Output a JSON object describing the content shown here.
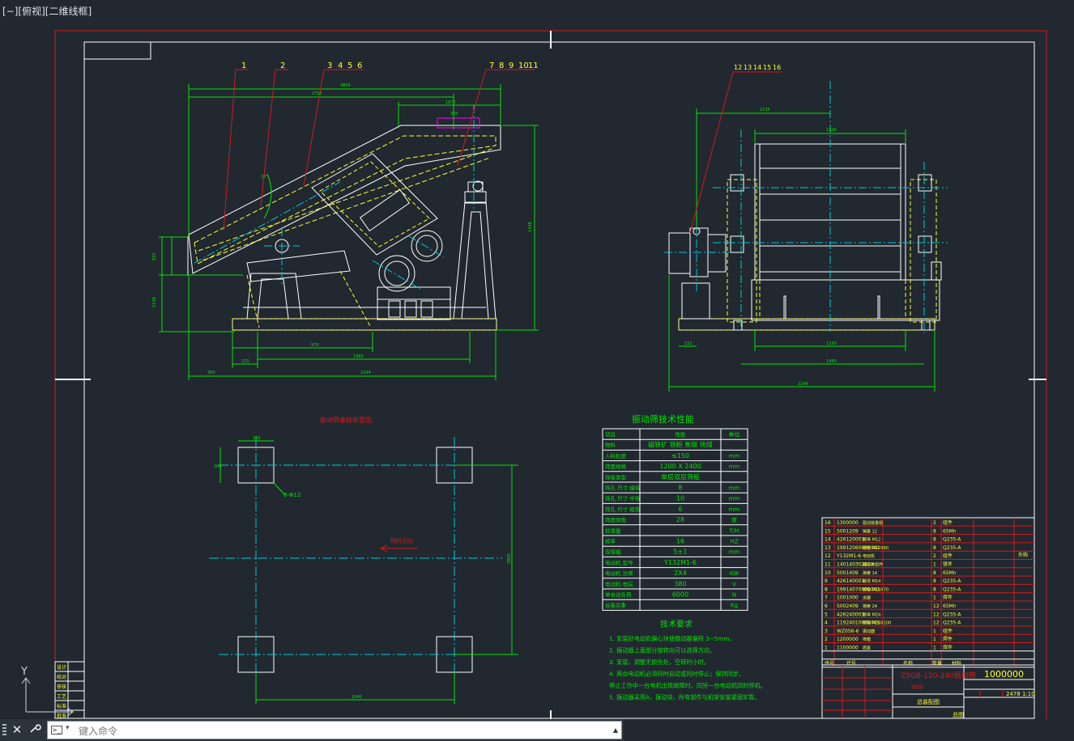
{
  "viewport": {
    "label": "[−][俯视][二维线框]"
  },
  "ucs": {
    "y_label": "Y"
  },
  "command_line": {
    "placeholder": "键入命令",
    "close_icon": "close-icon",
    "customize_icon": "wrench-icon",
    "prompt_icon": "command-prompt-icon"
  },
  "colors": {
    "background": "#212830",
    "frame": "#d51a1a",
    "geometry": "#ffffff",
    "dimension": "#00e600",
    "center_line": "#00c8d6",
    "hidden": "#ffff33",
    "magenta": "#ff00ff"
  },
  "drawing": {
    "callouts_left": [
      "1",
      "2",
      "3",
      "4",
      "5",
      "6",
      "7",
      "8",
      "9",
      "10",
      "11"
    ],
    "callouts_right": [
      "12",
      "13",
      "14",
      "15",
      "16"
    ],
    "side_view_dims": {
      "top_overall": "3869",
      "top_inner": "2752",
      "top_right": "1870",
      "bottom_1": "970",
      "bottom_2": "1960",
      "bottom_left": "220",
      "bottom_total": "2244",
      "bottom_offset": "360",
      "height": "1438",
      "left_upper": "835",
      "left_lower": "1148",
      "angle": "20°"
    },
    "end_view_dims": {
      "top": "1326",
      "top_left": "1135",
      "bottom_inner": "1250",
      "bottom_mid": "1480",
      "bottom_total": "2244",
      "left_small": "152"
    },
    "foundation": {
      "title": "振动筛基础布置图",
      "dim_top": "300",
      "dim_left": "300",
      "bore_label": "8-Φ12",
      "direction_label": "物料方向",
      "dim_bottom": "1640",
      "dim_right": "2800"
    }
  },
  "spec_table": {
    "title": "振动筛技术性能",
    "header": [
      "项目",
      "性能",
      "单位"
    ],
    "rows": [
      [
        "物料",
        "磁铁矿 铁粉 焦碳 块煤",
        ""
      ],
      [
        "入料粒度",
        "≤150",
        "mm"
      ],
      [
        "筛面规格",
        "1200 X 2400",
        "mm"
      ],
      [
        "筛板类型",
        "单层双层筛板",
        ""
      ],
      [
        "筛孔 尺寸 细筛",
        "8",
        "mm"
      ],
      [
        "筛孔 尺寸 中筛",
        "10",
        "mm"
      ],
      [
        "筛孔 尺寸 粗筛",
        "6",
        "mm"
      ],
      [
        "筛面倾角",
        "28",
        "度"
      ],
      [
        "处理量",
        "",
        "T/H"
      ],
      [
        "频率",
        "16",
        "HZ"
      ],
      [
        "双振幅",
        "5±1",
        "mm"
      ],
      [
        "电动机 型号",
        "Y132M1-6",
        ""
      ],
      [
        "电动机 功率",
        "2X4",
        "KW"
      ],
      [
        "电动机 电压",
        "380",
        "V"
      ],
      [
        "单台动负荷",
        "6000",
        "N"
      ],
      [
        "设备总重",
        "",
        "Kg"
      ]
    ]
  },
  "tech_requirements": {
    "title": "技术要求",
    "items": [
      "1. 安装好电动机偏心块使振动器偏转 3~5mm。",
      "2. 振动器上面部分按转向可以选择方向。",
      "3. 安装，调整无损伤处，空转时小时。",
      "4. 两台电动机必须同时启动或同时停止；保持同步。",
      "   停止工作中一台电机出现故障时，同另一台电动机同时停机。",
      "5. 振动器采用A，振动块，所有部件与机架安装紧固牢靠。"
    ]
  },
  "bom": {
    "rows": [
      [
        "16",
        "1300000",
        "驱动装置组",
        "2",
        "组件"
      ],
      [
        "15",
        "5001209",
        "弹簧 12",
        "8",
        "65Mn"
      ],
      [
        "14",
        "426120001",
        "螺母 M12",
        "8",
        "Q235-A"
      ],
      [
        "13",
        "19912060000001",
        "螺栓 M12X60",
        "8",
        "Q235-A"
      ],
      [
        "12",
        "Y132M1-6",
        "电动机",
        "2",
        "组件"
      ],
      [
        "11",
        "1401403026BX",
        "偏心块组件",
        "1",
        "铸件"
      ],
      [
        "10",
        "5001409",
        "弹簧 14",
        "8",
        "65Mn"
      ],
      [
        "9",
        "426140001",
        "螺母 M14",
        "8",
        "Q235-A"
      ],
      [
        "8",
        "19914070000001",
        "螺栓 M14X70",
        "8",
        "Q235-A"
      ],
      [
        "7",
        "1001000",
        "支腿",
        "1",
        "焊件"
      ],
      [
        "6",
        "5002409",
        "弹簧 24",
        "12",
        "65Mn"
      ],
      [
        "5",
        "426240001",
        "螺母 M24",
        "12",
        "Q235-A"
      ],
      [
        "4",
        "11924010000001",
        "螺栓 M24X100",
        "12",
        "Q235-A"
      ],
      [
        "3",
        "WZ056-6",
        "振动器",
        "1",
        "组件"
      ],
      [
        "2",
        "1200000",
        "筛箱",
        "1",
        "焊件"
      ],
      [
        "1",
        "1100000",
        "底座",
        "1",
        "焊件"
      ]
    ],
    "header": [
      "序号",
      "代号",
      "名称",
      "数量",
      "材料"
    ],
    "extra_note": "外购"
  },
  "title_block": {
    "drawing_title": "ZSGB-120-240振动筛",
    "drawing_number": "1000000",
    "view_name": "总装配图",
    "weight": "2478",
    "scale": "1:10",
    "unit": "总图",
    "sub_title": "装配图"
  },
  "side_panel": {
    "rows": [
      "设计",
      "校对",
      "审核",
      "工艺",
      "标准",
      "批准"
    ]
  }
}
